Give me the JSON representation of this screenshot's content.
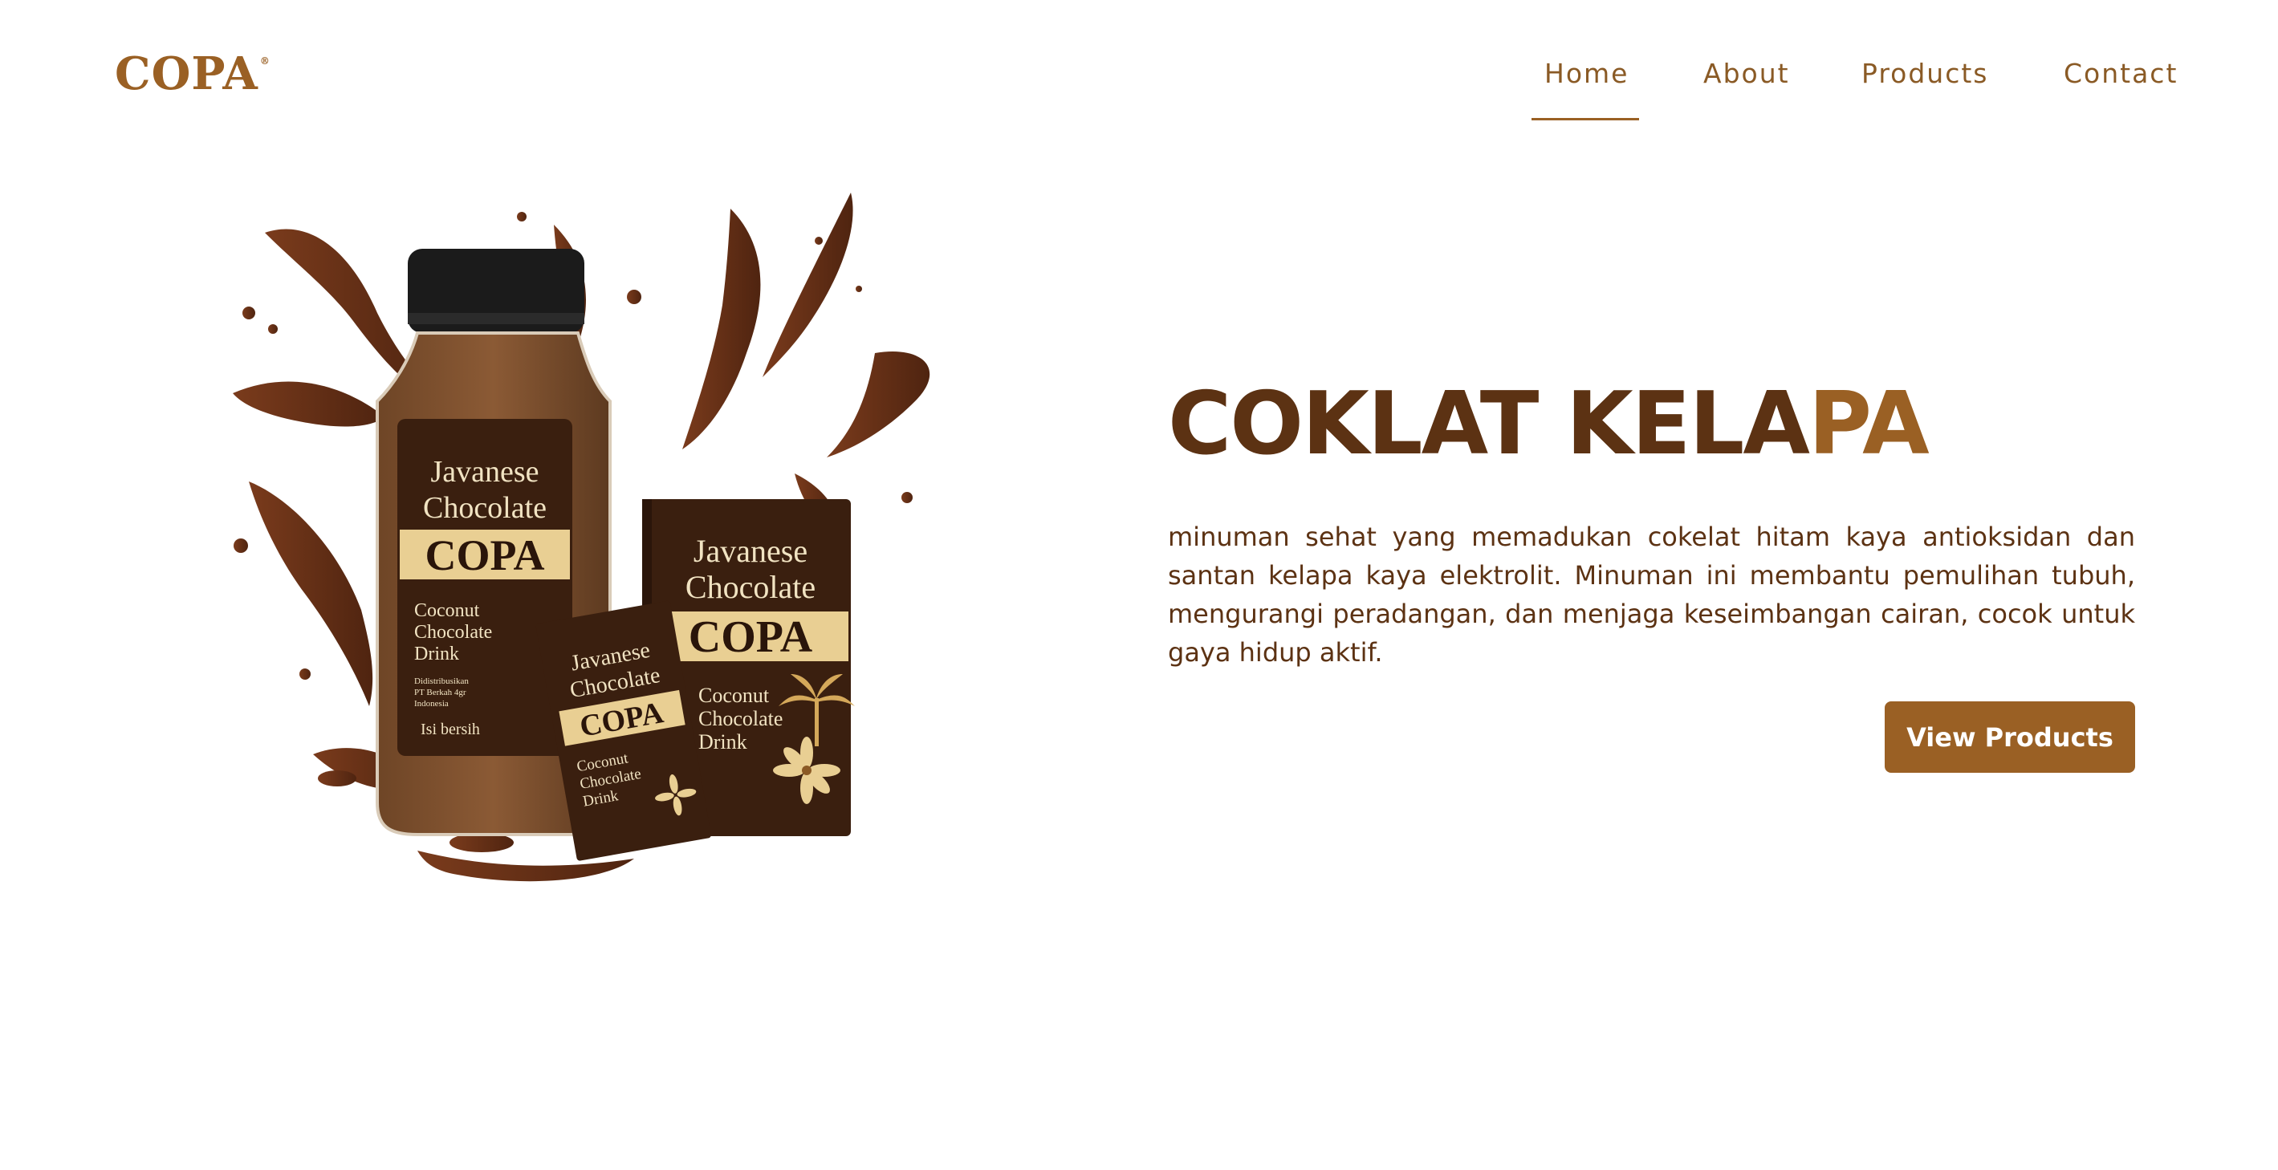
{
  "brand": {
    "logo_text": "COPA",
    "registered_mark": "®"
  },
  "nav": {
    "items": [
      {
        "label": "Home",
        "active": true
      },
      {
        "label": "About",
        "active": false
      },
      {
        "label": "Products",
        "active": false
      },
      {
        "label": "Contact",
        "active": false
      }
    ]
  },
  "hero": {
    "headline_start": "COKLAT KELA",
    "headline_accent": "PA",
    "description": "minuman sehat yang memadukan cokelat hitam kaya antioksidan dan santan kelapa kaya elektrolit. Minuman ini membantu pemulihan tubuh, mengurangi peradangan, dan menjaga keseimbangan cairan, cocok untuk gaya hidup aktif.",
    "cta_label": "View Products"
  },
  "product_art": {
    "bottle_label_line1": "Javanese",
    "bottle_label_line2": "Chocolate",
    "bottle_brand": "COPA",
    "bottle_sub1": "Coconut",
    "bottle_sub2": "Chocolate",
    "bottle_sub3": "Drink",
    "bottle_fine1": "Didistribusikan",
    "bottle_fine2": "PT Berkah 4gr",
    "bottle_fine3": "Indonesia",
    "bottle_content": "Isi bersih",
    "box_label_line1": "Javanese",
    "box_label_line2": "Chocolate",
    "box_brand": "COPA",
    "box_sub1": "Coconut",
    "box_sub2": "Chocolate",
    "box_sub3": "Drink",
    "sachet_label_line1": "Javanese",
    "sachet_label_line2": "Chocolate",
    "sachet_brand": "COPA",
    "sachet_sub1": "Coconut",
    "sachet_sub2": "Chocolate",
    "sachet_sub3": "Drink"
  },
  "colors": {
    "brand_brown": "#9a6024",
    "dark_brown": "#5c3213",
    "package_dark": "#3a1f0f",
    "label_gold": "#e9cf93",
    "chocolate_splash": "#6b3418"
  }
}
